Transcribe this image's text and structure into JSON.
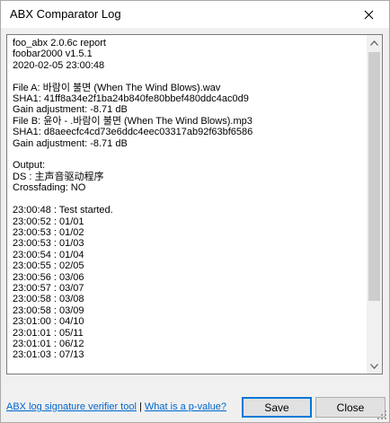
{
  "window": {
    "title": "ABX Comparator Log"
  },
  "log": {
    "lines": [
      "foo_abx 2.0.6c report",
      "foobar2000 v1.5.1",
      "2020-02-05 23:00:48",
      "",
      "File A: 바람이 불면 (When The Wind Blows).wav",
      "SHA1: 41ff8a34e2f1ba24b840fe80bbef480ddc4ac0d9",
      "Gain adjustment: -8.71 dB",
      "File B: 윤아 - .바람이 불면 (When The Wind Blows).mp3",
      "SHA1: d8aeecfc4cd73e6ddc4eec03317ab92f63bf6586",
      "Gain adjustment: -8.71 dB",
      "",
      "Output:",
      "DS : 主声音驱动程序",
      "Crossfading: NO",
      "",
      "23:00:48 : Test started.",
      "23:00:52 : 01/01",
      "23:00:53 : 01/02",
      "23:00:53 : 01/03",
      "23:00:54 : 01/04",
      "23:00:55 : 02/05",
      "23:00:56 : 03/06",
      "23:00:57 : 03/07",
      "23:00:58 : 03/08",
      "23:00:58 : 03/09",
      "23:01:00 : 04/10",
      "23:01:01 : 05/11",
      "23:01:01 : 06/12",
      "23:01:03 : 07/13"
    ]
  },
  "footer": {
    "link_verifier": "ABX log signature verifier tool",
    "separator": "|",
    "link_pvalue": "What is a p-value?",
    "save_label": "Save",
    "close_label": "Close"
  }
}
